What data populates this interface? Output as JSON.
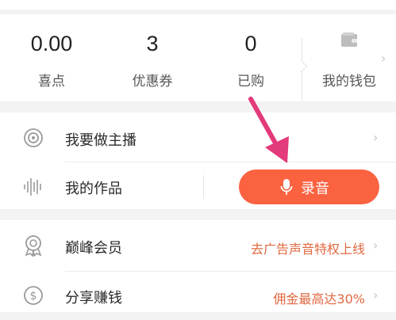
{
  "stats": [
    {
      "value": "0.00",
      "label": "喜点"
    },
    {
      "value": "3",
      "label": "优惠券"
    },
    {
      "value": "0",
      "label": "已购"
    }
  ],
  "wallet": {
    "label": "我的钱包",
    "icon": "wallet-icon"
  },
  "menu": {
    "host": {
      "label": "我要做主播",
      "icon": "broadcast-icon"
    },
    "works": {
      "label": "我的作品",
      "icon": "waveform-icon"
    },
    "record": {
      "label": "录音",
      "icon": "microphone-icon"
    },
    "vip": {
      "label": "巅峰会员",
      "promo": "去广告声音特权上线",
      "icon": "medal-icon"
    },
    "share": {
      "label": "分享赚钱",
      "promo": "佣金最高达30%",
      "icon": "dollar-coin-icon"
    }
  },
  "colors": {
    "accent": "#fa6240",
    "promo": "#e0683f",
    "annotation_arrow": "#e23a7a"
  }
}
